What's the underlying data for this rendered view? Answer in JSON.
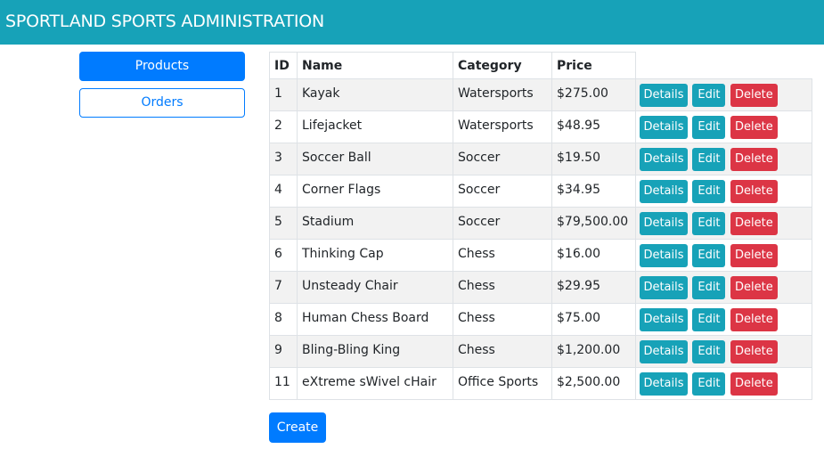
{
  "header": {
    "title": "SPORTLAND SPORTS ADMINISTRATION"
  },
  "nav": {
    "products_label": "Products",
    "orders_label": "Orders"
  },
  "table": {
    "columns": [
      "ID",
      "Name",
      "Category",
      "Price"
    ],
    "actions": {
      "details": "Details",
      "edit": "Edit",
      "delete": "Delete"
    },
    "rows": [
      {
        "id": "1",
        "name": "Kayak",
        "category": "Watersports",
        "price": "$275.00"
      },
      {
        "id": "2",
        "name": "Lifejacket",
        "category": "Watersports",
        "price": "$48.95"
      },
      {
        "id": "3",
        "name": "Soccer Ball",
        "category": "Soccer",
        "price": "$19.50"
      },
      {
        "id": "4",
        "name": "Corner Flags",
        "category": "Soccer",
        "price": "$34.95"
      },
      {
        "id": "5",
        "name": "Stadium",
        "category": "Soccer",
        "price": "$79,500.00"
      },
      {
        "id": "6",
        "name": "Thinking Cap",
        "category": "Chess",
        "price": "$16.00"
      },
      {
        "id": "7",
        "name": "Unsteady Chair",
        "category": "Chess",
        "price": "$29.95"
      },
      {
        "id": "8",
        "name": "Human Chess Board",
        "category": "Chess",
        "price": "$75.00"
      },
      {
        "id": "9",
        "name": "Bling-Bling King",
        "category": "Chess",
        "price": "$1,200.00"
      },
      {
        "id": "11",
        "name": "eXtreme sWivel cHair",
        "category": "Office Sports",
        "price": "$2,500.00"
      }
    ]
  },
  "create_label": "Create",
  "colors": {
    "header": "#17a2b8",
    "primary": "#007bff",
    "info": "#17a2b8",
    "danger": "#dc3545"
  }
}
